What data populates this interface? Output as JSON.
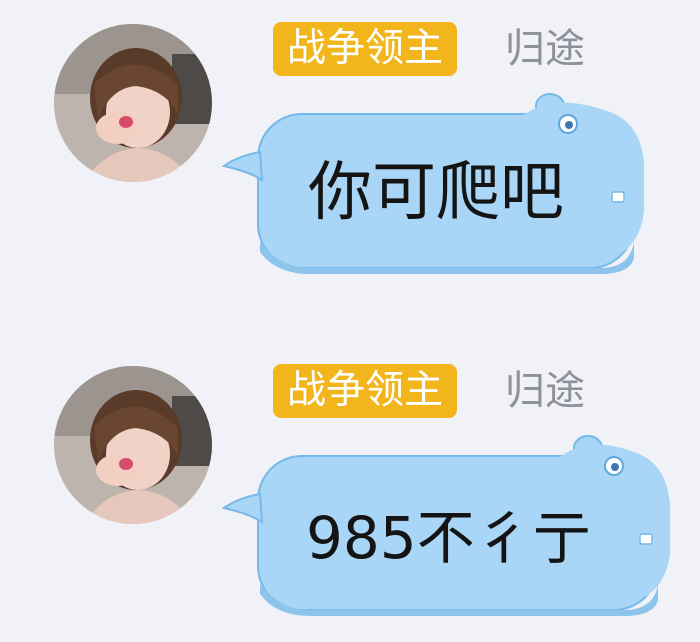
{
  "messages": [
    {
      "title_badge": "战争领主",
      "sender_name": "归途",
      "text": "你可爬吧"
    },
    {
      "title_badge": "战争领主",
      "sender_name": "归途",
      "text": "985不彳亍"
    }
  ],
  "colors": {
    "background": "#f1f2f7",
    "badge": "#f2b51c",
    "bubble_fill": "#a9d6f6",
    "bubble_outline": "#6db6ea",
    "name": "#8e909a"
  },
  "icons": {
    "avatar": "user-avatar-photo",
    "bubble": "hippo-shaped-chat-bubble"
  }
}
